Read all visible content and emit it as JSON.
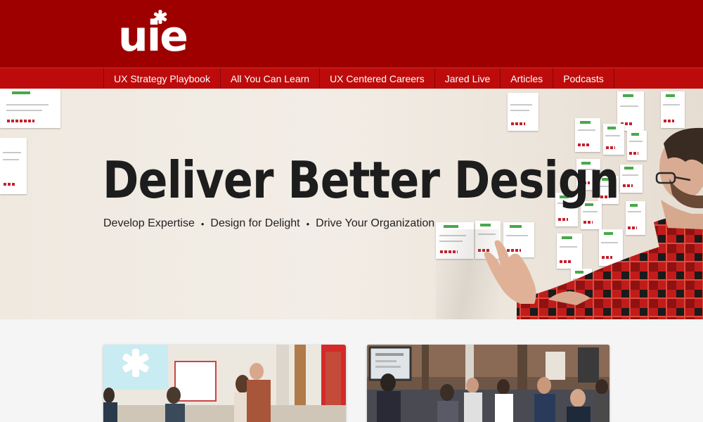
{
  "brand": {
    "logo_text": "uie",
    "colors": {
      "header": "#9e0000",
      "nav": "#bd0b0b",
      "accent_red": "#c41e2a"
    }
  },
  "nav": {
    "items": [
      {
        "label": "UX Strategy Playbook"
      },
      {
        "label": "All You Can Learn"
      },
      {
        "label": "UX Centered Careers"
      },
      {
        "label": "Jared Live"
      },
      {
        "label": "Articles"
      },
      {
        "label": "Podcasts"
      }
    ]
  },
  "hero": {
    "title": "Deliver Better Design",
    "subtitle": [
      "Develop Expertise",
      "Design for Delight",
      "Drive Your Organization"
    ],
    "separator": "•"
  },
  "cards": [
    {
      "image": "workshop-room-photo",
      "logo_icon": "uie-star-icon"
    },
    {
      "image": "conference-audience-photo"
    }
  ]
}
